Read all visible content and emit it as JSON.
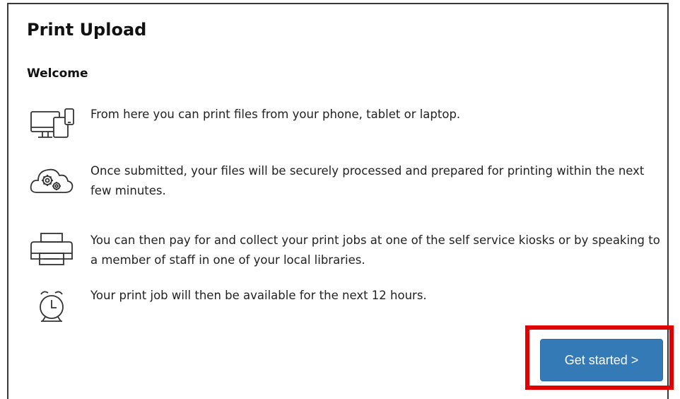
{
  "page": {
    "title": "Print Upload",
    "subtitle": "Welcome"
  },
  "steps": [
    {
      "icon": "devices-icon",
      "text": "From here you can print files from your phone, tablet or laptop."
    },
    {
      "icon": "cloud-gears-icon",
      "text": "Once submitted, your files will be securely processed and prepared for printing within the next few minutes."
    },
    {
      "icon": "printer-icon",
      "text": "You can then pay for and collect your print jobs at one of the self service kiosks or by speaking to a member of staff in one of your local libraries."
    },
    {
      "icon": "alarm-clock-icon",
      "text": "Your print job will then be available for the next 12 hours."
    }
  ],
  "actions": {
    "get_started_label": "Get started >"
  },
  "colors": {
    "button_bg": "#337ab7",
    "highlight": "#e00000"
  }
}
